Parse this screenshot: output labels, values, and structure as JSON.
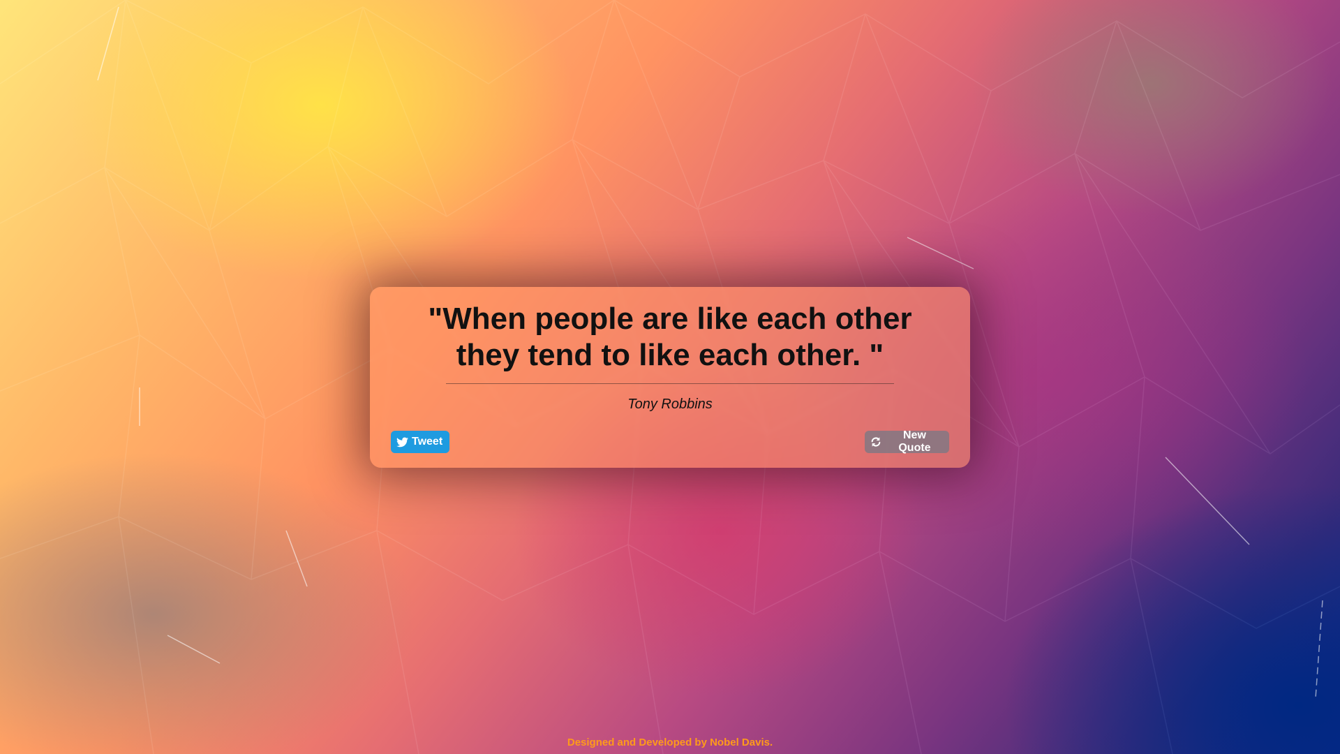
{
  "quote": {
    "text": "\"When people are like each other they tend to like each other. \"",
    "author": "Tony Robbins"
  },
  "buttons": {
    "tweet_label": "Tweet",
    "tweet_icon": "twitter-icon",
    "new_quote_label": "New Quote",
    "new_quote_icon": "refresh-icon"
  },
  "footer": {
    "credit": "Designed and Developed by Nobel Davis."
  },
  "colors": {
    "tweet_button": "#1e9be0",
    "footer_text": "#ff9b1a",
    "quote_text": "#111111"
  }
}
